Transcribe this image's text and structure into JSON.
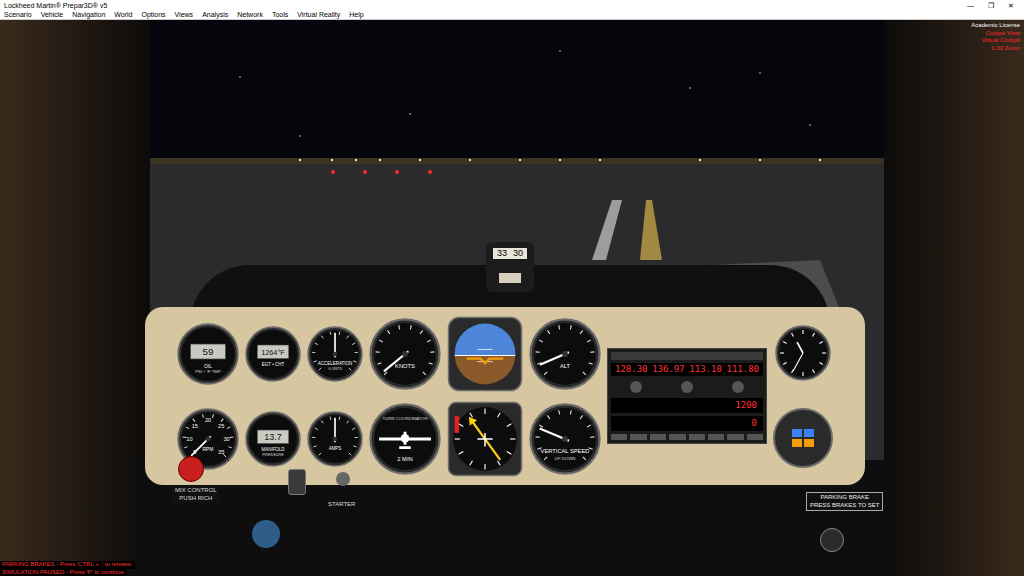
{
  "window": {
    "title": "Lockheed Martin® Prepar3D® v5",
    "controls": [
      "—",
      "❐",
      "✕"
    ]
  },
  "menu": [
    "Scenario",
    "Vehicle",
    "Navigation",
    "World",
    "Options",
    "Views",
    "Analysis",
    "Network",
    "Tools",
    "Virtual Reality",
    "Help"
  ],
  "overlay": {
    "license": "Academic License",
    "view": [
      "Cockpit View",
      "Virtual Cockpit",
      "1.00 Zoom"
    ]
  },
  "messages": [
    "PARKING BRAKES - Press 'CTRL + .' to release.",
    "SIMULATION PAUSED - Press 'P' to continue."
  ],
  "compass": {
    "marks": [
      "33",
      "30"
    ]
  },
  "columns": [
    [
      {
        "name": "oil-gauge",
        "kind": "digital",
        "value": "59",
        "label": "OIL",
        "sub": "PSI • °F TMP"
      },
      {
        "name": "tachometer",
        "kind": "dial",
        "label": "RPM",
        "sub": "",
        "ticks": [
          "5",
          "10",
          "15",
          "20",
          "25",
          "30",
          "35"
        ],
        "level": 0.0
      }
    ],
    [
      {
        "name": "egt-gauge",
        "kind": "digital",
        "value": "1264°F",
        "label": "EGT • CHT",
        "sub": ""
      },
      {
        "name": "manifold-pressure-gauge",
        "kind": "digital",
        "value": "13.7",
        "label": "MANIFOLD",
        "sub": "PRESSURE"
      }
    ],
    [
      {
        "name": "acceleration-gauge",
        "kind": "dial",
        "label": "ACCELERATION",
        "sub": "G UNITS",
        "ticks": [],
        "level": 0.5
      },
      {
        "name": "ammeter",
        "kind": "dial",
        "label": "AMPS",
        "sub": "",
        "ticks": [],
        "level": 0.5
      }
    ],
    [
      {
        "name": "airspeed-indicator",
        "kind": "dial",
        "label": "KNOTS",
        "sub": "",
        "ticks": [],
        "level": 0.02
      },
      {
        "name": "turn-coordinator",
        "kind": "turn",
        "label": "TURN COORDINATOR",
        "sub": "2 MIN"
      }
    ],
    [
      {
        "name": "attitude-indicator",
        "kind": "attitude"
      },
      {
        "name": "heading-indicator",
        "kind": "hsi",
        "level": 0.9
      }
    ],
    [
      {
        "name": "altimeter",
        "kind": "dial",
        "label": "ALT",
        "sub": "",
        "ticks": [],
        "level": 0.08
      },
      {
        "name": "vertical-speed-indicator",
        "kind": "dial",
        "label": "VERTICAL SPEED",
        "sub": "UP DOWN",
        "ticks": [],
        "level": 0.25
      }
    ]
  ],
  "radio": {
    "com_active": "128.30",
    "com_standby": "136.97",
    "nav_active": "113.10",
    "nav_standby": "111.80",
    "transponder": "1200",
    "adf": "0"
  },
  "clock": {
    "hour": 0.92,
    "minute": 0.58
  },
  "placards": {
    "mixture": [
      "MIX CONTROL",
      "PUSH RICH"
    ],
    "starter": "STARTER",
    "brake": [
      "PARKING BRAKE",
      "PRESS BRAKES TO SET"
    ]
  }
}
